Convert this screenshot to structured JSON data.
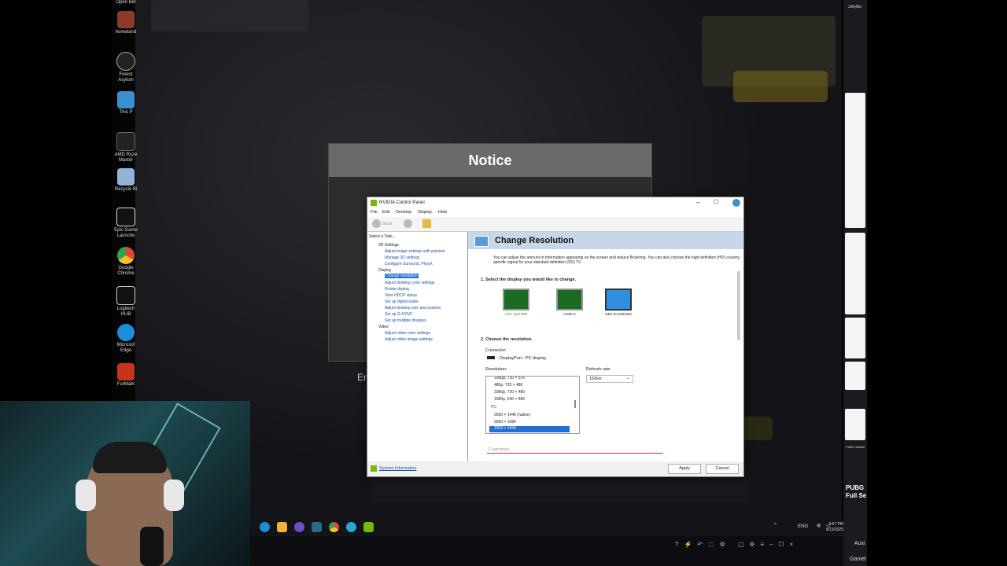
{
  "desktop": {
    "icons": [
      {
        "label": "Open Bet",
        "icon": "app-icon",
        "color": "#333"
      },
      {
        "label": "homeland",
        "icon": "app-icon",
        "color": "#8a3b2a"
      },
      {
        "label": "Forest Asylum",
        "icon": "unreal-icon",
        "color": "#222"
      },
      {
        "label": "This P",
        "icon": "computer-icon",
        "color": "#3a8fd0"
      },
      {
        "label": "AMD Ryze Master",
        "icon": "amd-icon",
        "color": "#222"
      },
      {
        "label": "Recycle Bi",
        "icon": "recycle-bin-icon",
        "color": "#8fb4d8"
      },
      {
        "label": "Epic Game Launche",
        "icon": "epic-games-icon",
        "color": "#111"
      },
      {
        "label": "Google Chrome",
        "icon": "chrome-icon",
        "color": "#e0463a"
      },
      {
        "label": "Logitech HUB",
        "icon": "logitech-icon",
        "color": "#111"
      },
      {
        "label": "Microsof Edge",
        "icon": "edge-icon",
        "color": "#1d8fd8"
      },
      {
        "label": "FurMark",
        "icon": "furmark-icon",
        "color": "#c7321d"
      }
    ]
  },
  "game": {
    "notice_title": "Notice",
    "side_text": "En"
  },
  "nvidia": {
    "window_title": "NVIDIA Control Panel",
    "menu": [
      "File",
      "Edit",
      "Desktop",
      "Display",
      "Help"
    ],
    "back_label": "Back",
    "select_task": "Select a Task...",
    "tree": [
      {
        "label": "3D Settings",
        "level": 0
      },
      {
        "label": "Adjust image settings with preview",
        "level": 1
      },
      {
        "label": "Manage 3D settings",
        "level": 1
      },
      {
        "label": "Configure Surround, PhysX",
        "level": 1
      },
      {
        "label": "Display",
        "level": 0
      },
      {
        "label": "Change resolution",
        "level": 1,
        "selected": true
      },
      {
        "label": "Adjust desktop color settings",
        "level": 1
      },
      {
        "label": "Rotate display",
        "level": 1
      },
      {
        "label": "View HDCP status",
        "level": 1
      },
      {
        "label": "Set up digital audio",
        "level": 1
      },
      {
        "label": "Adjust desktop size and position",
        "level": 1
      },
      {
        "label": "Set up G-SYNC",
        "level": 1
      },
      {
        "label": "Set up multiple displays",
        "level": 1
      },
      {
        "label": "Video",
        "level": 0
      },
      {
        "label": "Adjust video color settings",
        "level": 1
      },
      {
        "label": "Adjust video image settings",
        "level": 1
      }
    ],
    "page_title": "Change Resolution",
    "description": "You can adjust the amount of information appearing on the screen and reduce flickering. You can also choose the high-definition (HD) country-specific signal for your standard-definition (SD) TV.",
    "step1": "1. Select the display you would like to change.",
    "displays": [
      {
        "label": "AOC Q3279W",
        "selected": true
      },
      {
        "label": "HD60 X",
        "selected": false
      },
      {
        "label": "NEC EA294WMi",
        "selected": false
      }
    ],
    "step2": "2. Choose the resolution.",
    "connector_label": "Connector:",
    "connector_value": "DisplayPort - PC display",
    "resolution_label": "Resolution:",
    "refresh_label": "Refresh rate:",
    "refresh_value": "165Hz",
    "resolutions": [
      "1080p, 720 × 576",
      "480p, 720 × 480",
      "1080p, 720 × 480",
      "1080p, 640 × 480",
      "PC",
      "2560 × 1440 (native)",
      "2560 × 1080",
      "1920 × 1440"
    ],
    "customize_label": "Customize...",
    "system_info": "System Information",
    "apply": "Apply",
    "cancel": "Cancel"
  },
  "taskbar": {
    "lang": "ENG",
    "time": "3:57 PM",
    "date": "9/13/2025",
    "aux_label": "Auxi",
    "game_label": "Gamel"
  },
  "right_panel": {
    "header": "JollyMa",
    "pubg_small": "PUBG Mobile",
    "pubg_big": "PUBG Full Se"
  }
}
